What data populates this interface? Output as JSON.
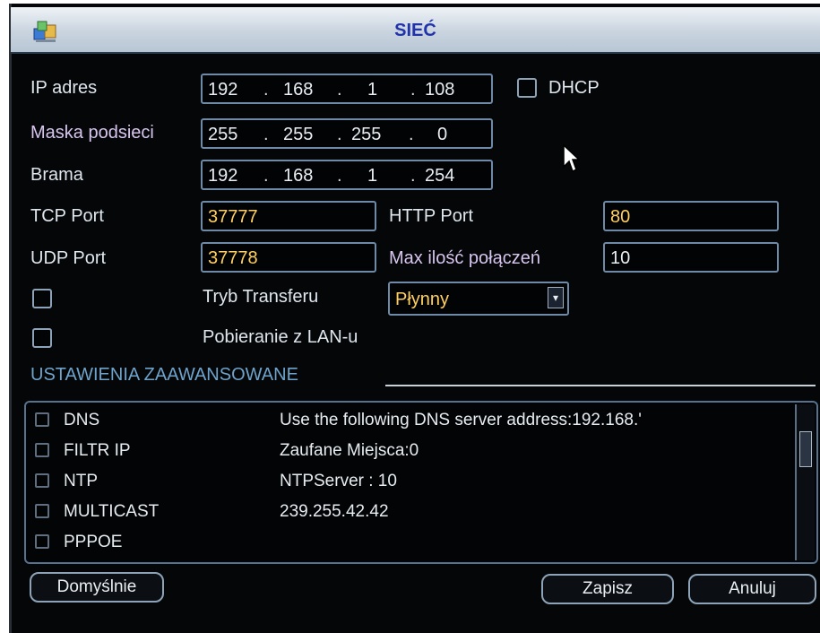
{
  "title": "SIEĆ",
  "ip": {
    "label": "IP adres",
    "octets": [
      "192",
      "168",
      "1",
      "108"
    ]
  },
  "dhcp": {
    "label": "DHCP"
  },
  "mask": {
    "label": "Maska podsieci",
    "octets": [
      "255",
      "255",
      "255",
      "0"
    ]
  },
  "gateway": {
    "label": "Brama",
    "octets": [
      "192",
      "168",
      "1",
      "254"
    ]
  },
  "tcp_port": {
    "label": "TCP Port",
    "value": "37777"
  },
  "http_port": {
    "label": "HTTP Port",
    "value": "80"
  },
  "udp_port": {
    "label": "UDP Port",
    "value": "37778"
  },
  "max_connections": {
    "label": "Max ilość połączeń",
    "value": "10"
  },
  "transfer_mode": {
    "label": "Tryb Transferu",
    "value": "Płynny"
  },
  "lan_download": {
    "label": "Pobieranie z LAN-u"
  },
  "advanced": {
    "label": "USTAWIENIA ZAAWANSOWANE",
    "rows": [
      {
        "name": "DNS",
        "value": "Use the following DNS server address:192.168.'"
      },
      {
        "name": "FILTR IP",
        "value": "Zaufane Miejsca:0"
      },
      {
        "name": "NTP",
        "value": "NTPServer : 10"
      },
      {
        "name": "MULTICAST",
        "value": "239.255.42.42"
      },
      {
        "name": "PPPOE",
        "value": ""
      }
    ]
  },
  "buttons": {
    "default": "Domyślnie",
    "save": "Zapisz",
    "cancel": "Anuluj"
  },
  "icons": {
    "app": "network-config-icon",
    "dropdown": "chevron-down-icon",
    "cursor": "mouse-pointer-icon"
  },
  "colors": {
    "accent": "#ffd060",
    "title_text": "#2233aa",
    "section": "#6ea3cc"
  }
}
